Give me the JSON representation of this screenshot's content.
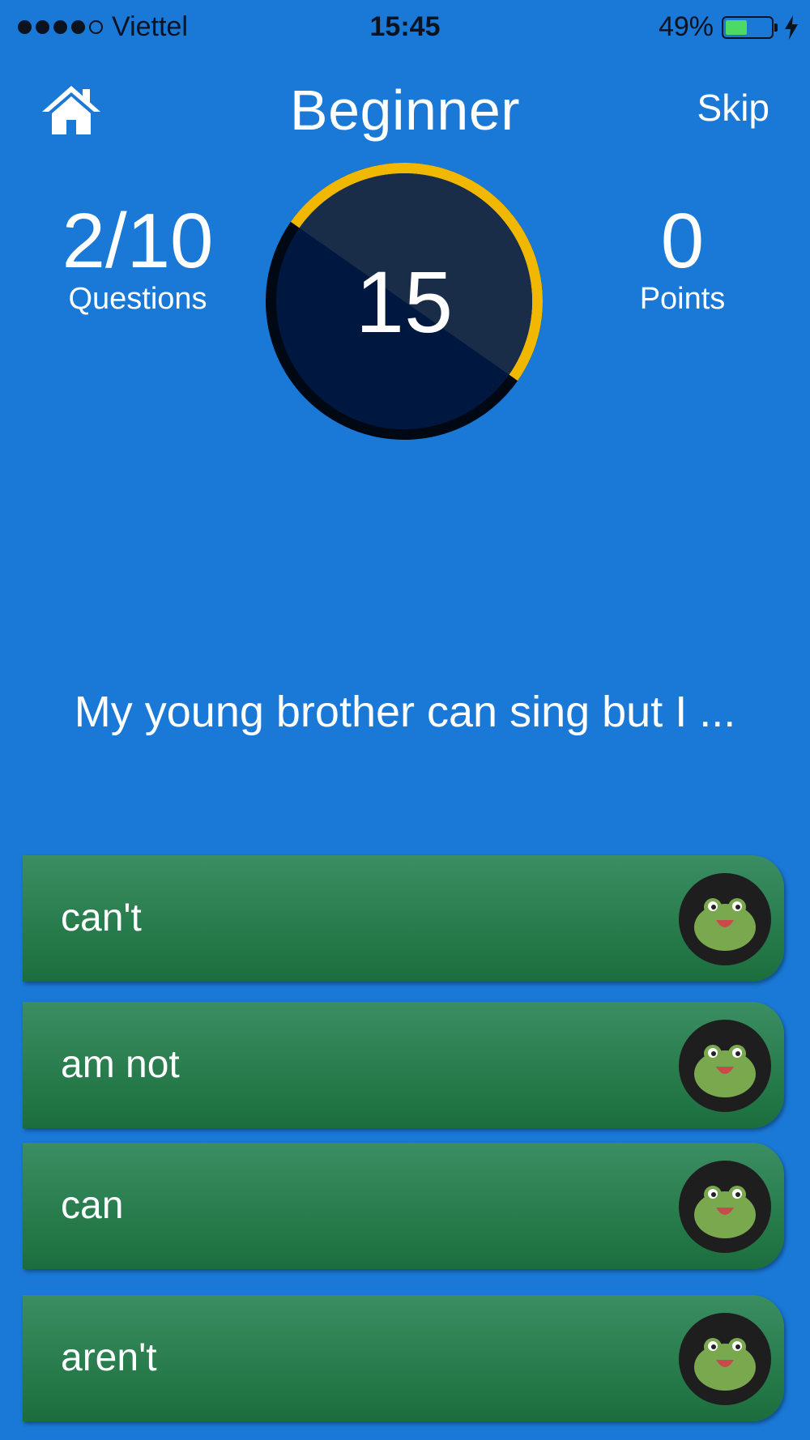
{
  "status_bar": {
    "carrier": "Viettel",
    "time": "15:45",
    "battery_percent": "49%",
    "battery_level": 0.49,
    "signal_bars_filled": 4,
    "signal_bars_total": 5
  },
  "header": {
    "home_icon": "home-icon",
    "title": "Beginner",
    "skip_label": "Skip"
  },
  "stats": {
    "questions_value": "2/10",
    "questions_label": "Questions",
    "points_value": "0",
    "points_label": "Points"
  },
  "timer": {
    "value": "15",
    "progress_fraction": 0.5,
    "ring_color": "#f0b800",
    "dial_color": "#00183f"
  },
  "question": {
    "text": "My young brother can sing but I ..."
  },
  "answers": [
    {
      "label": "can't",
      "icon": "frog-avatar-icon"
    },
    {
      "label": "am not",
      "icon": "frog-avatar-icon"
    },
    {
      "label": "can",
      "icon": "frog-avatar-icon"
    },
    {
      "label": "aren't",
      "icon": "frog-avatar-icon"
    }
  ],
  "colors": {
    "background": "#1a78d6",
    "answer_gradient_top": "#3a8e62",
    "answer_gradient_bottom": "#1b6e3c",
    "frog": "#7aa84f"
  }
}
